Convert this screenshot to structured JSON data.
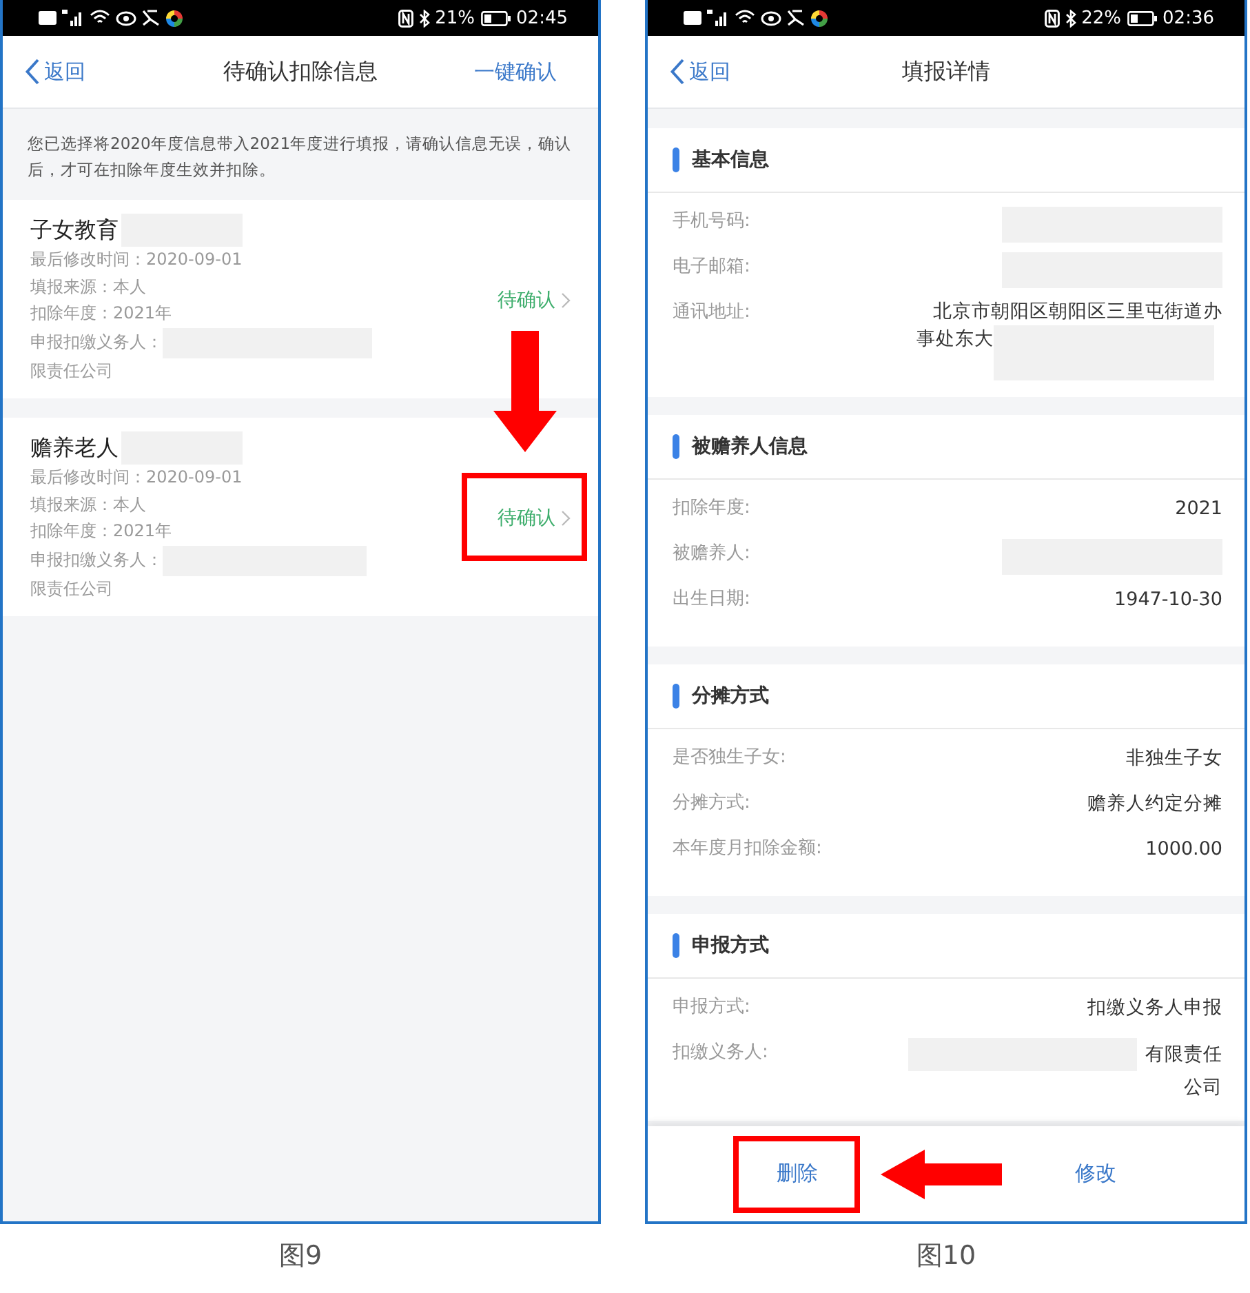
{
  "figures": [
    {
      "kind": "list",
      "caption": "图9",
      "status_bar": {
        "battery": "21%",
        "time": "02:45"
      },
      "nav": {
        "back": "返回",
        "title": "待确认扣除信息",
        "action": "一键确认"
      },
      "notice": "您已选择将2020年度信息带入2021年度进行填报，请确认信息无误，确认后，才可在扣除年度生效并扣除。",
      "items": [
        {
          "title": "子女教育",
          "lines": [
            "最后修改时间：2020-09-01",
            "填报来源：本人",
            "扣除年度：2021年"
          ],
          "agent_label": "申报扣缴义务人：",
          "agent_tail": "限责任公司",
          "status": "待确认",
          "highlighted": false
        },
        {
          "title": "赡养老人",
          "lines": [
            "最后修改时间：2020-09-01",
            "填报来源：本人",
            "扣除年度：2021年"
          ],
          "agent_label": "申报扣缴义务人：",
          "agent_tail": "限责任公司",
          "status": "待确认",
          "highlighted": true
        }
      ]
    },
    {
      "kind": "detail",
      "caption": "图10",
      "status_bar": {
        "battery": "22%",
        "time": "02:36"
      },
      "nav": {
        "back": "返回",
        "title": "填报详情"
      },
      "sections": [
        {
          "title": "基本信息",
          "rows": [
            {
              "kind": "redacted",
              "label": "手机号码:"
            },
            {
              "kind": "redacted",
              "label": "电子邮箱:"
            },
            {
              "kind": "address",
              "label": "通讯地址:",
              "first": "北京市朝阳区朝阳区三里屯街道办",
              "rest": "事处东大"
            }
          ]
        },
        {
          "title": "被赡养人信息",
          "rows": [
            {
              "kind": "text",
              "label": "扣除年度:",
              "value": "2021"
            },
            {
              "kind": "redacted",
              "label": "被赡养人:"
            },
            {
              "kind": "text",
              "label": "出生日期:",
              "value": "1947-10-30"
            }
          ]
        },
        {
          "title": "分摊方式",
          "rows": [
            {
              "kind": "text",
              "label": "是否独生子女:",
              "value": "非独生子女"
            },
            {
              "kind": "text",
              "label": "分摊方式:",
              "value": "赡养人约定分摊"
            },
            {
              "kind": "text",
              "label": "本年度月扣除金额:",
              "value": "1000.00"
            }
          ]
        },
        {
          "title": "申报方式",
          "rows": [
            {
              "kind": "text",
              "label": "申报方式:",
              "value": "扣缴义务人申报"
            },
            {
              "kind": "agent",
              "label": "扣缴义务人:",
              "value": "有限责任公司"
            }
          ]
        }
      ],
      "buttons": [
        {
          "label": "删除",
          "highlighted": true
        },
        {
          "label": "修改",
          "highlighted": false
        }
      ]
    }
  ]
}
